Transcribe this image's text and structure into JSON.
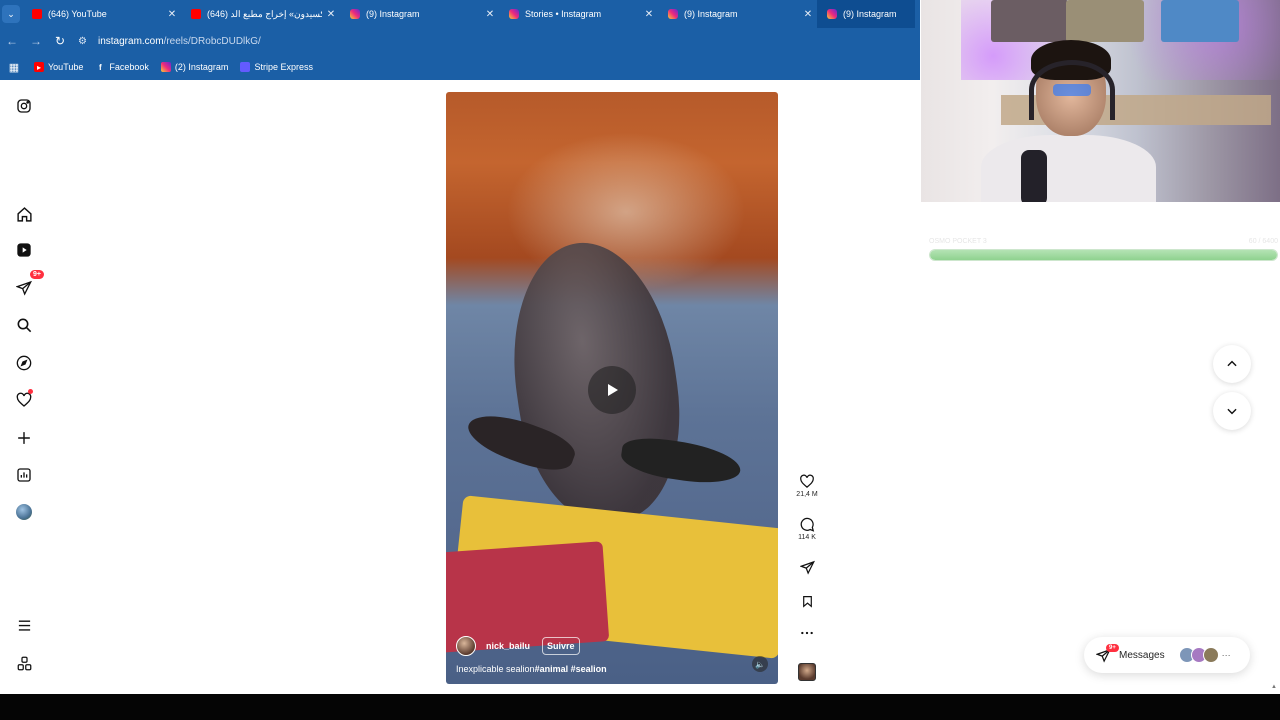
{
  "browser": {
    "tabs": [
      {
        "title": "(646) YouTube",
        "favicon": "youtube-icon",
        "active": false
      },
      {
        "title": "(646) أكسيدون» إخراج مطبع الد...",
        "favicon": "youtube-icon",
        "active": false
      },
      {
        "title": "(9) Instagram",
        "favicon": "instagram-icon",
        "active": false
      },
      {
        "title": "Stories • Instagram",
        "favicon": "instagram-icon",
        "active": false
      },
      {
        "title": "(9) Instagram",
        "favicon": "instagram-icon",
        "active": false
      },
      {
        "title": "(9) Instagram",
        "favicon": "instagram-icon",
        "active": true
      }
    ],
    "url_host": "instagram.com",
    "url_path": "/reels/DRobcDUDlkG/",
    "bookmarks": [
      {
        "label": "YouTube",
        "icon": "youtube-icon"
      },
      {
        "label": "Facebook",
        "icon": "facebook-icon"
      },
      {
        "label": "(2) Instagram",
        "icon": "instagram-icon"
      },
      {
        "label": "Stripe Express",
        "icon": "stripe-icon"
      }
    ],
    "chrome_color": "#1b5fa6"
  },
  "sidebar": {
    "items": [
      {
        "name": "home-icon"
      },
      {
        "name": "reels-icon"
      },
      {
        "name": "direct-messages-icon",
        "badge": "9+"
      },
      {
        "name": "search-icon"
      },
      {
        "name": "explore-icon"
      },
      {
        "name": "notifications-icon",
        "dot": true
      },
      {
        "name": "create-icon"
      },
      {
        "name": "dashboard-icon"
      },
      {
        "name": "profile-avatar"
      }
    ]
  },
  "reel": {
    "author": "nick_bailu",
    "follow_label": "Suivre",
    "caption_text": "Inexplicable sealion",
    "caption_tags": "#animal #sealion"
  },
  "actions": {
    "likes": "21,4 M",
    "comments": "114 K"
  },
  "messages": {
    "label": "Messages",
    "badge": "9+"
  },
  "pocket": {
    "label": "OSMO POCKET 3",
    "value": "60 / 6400",
    "progress": 1.0
  }
}
